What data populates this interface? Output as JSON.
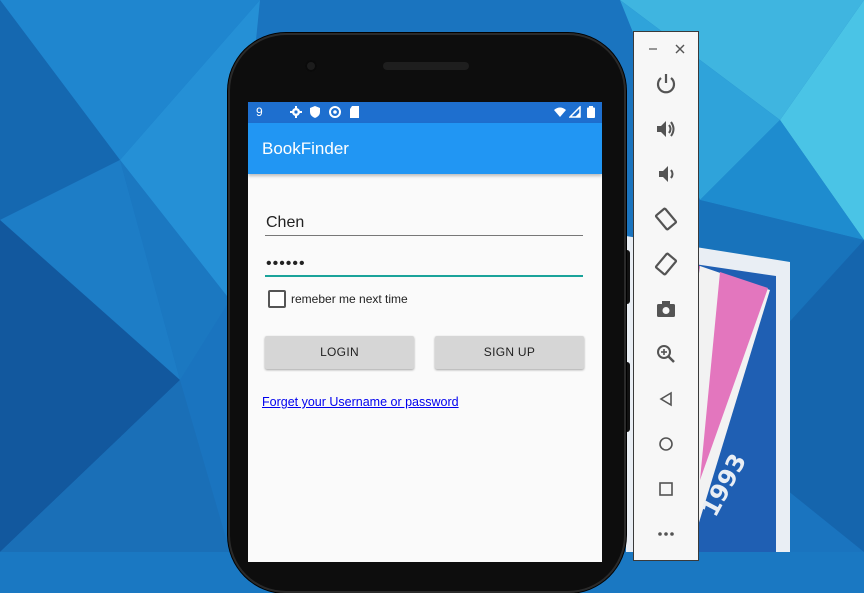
{
  "status_bar": {
    "time": "9"
  },
  "app": {
    "title": "BookFinder"
  },
  "login_form": {
    "username_value": "Chen",
    "password_value": "••••••",
    "remember_label": "remeber me next time",
    "remember_checked": false,
    "login_label": "LOGIN",
    "signup_label": "SIGN UP",
    "forget_link": "Forget your Username or password"
  },
  "emulator_toolbar": {
    "buttons": [
      "power-icon",
      "volume-up-icon",
      "volume-down-icon",
      "rotate-left-icon",
      "rotate-right-icon",
      "camera-icon",
      "zoom-icon",
      "back-icon",
      "home-icon",
      "overview-icon",
      "more-icon"
    ]
  },
  "background_logo": {
    "text": "1993"
  },
  "colors": {
    "app_bar": "#2196f3",
    "status_bar": "#1e6fcf",
    "accent_underline": "#1aa39a",
    "link": "#0000ee"
  }
}
